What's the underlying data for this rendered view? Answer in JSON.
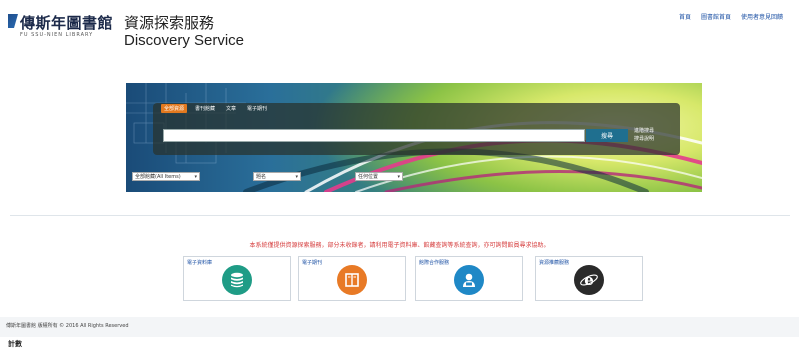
{
  "header": {
    "logo_text": "傳斯年圖書館",
    "logo_subtext": "FU SSU-NIEN LIBRARY",
    "title_zh": "資源探索服務",
    "title_en": "Discovery Service",
    "links": [
      {
        "label": "首頁"
      },
      {
        "label": "圖書館首頁"
      },
      {
        "label": "使用者意見回饋"
      }
    ]
  },
  "search": {
    "tabs": [
      {
        "label": "全部資源",
        "active": true
      },
      {
        "label": "書刊館藏",
        "active": false
      },
      {
        "label": "文章",
        "active": false
      },
      {
        "label": "電子期刊",
        "active": false
      }
    ],
    "input_value": "",
    "input_placeholder": "",
    "button_label": "搜尋",
    "advanced_label": "進階搜尋",
    "help_label": "搜尋說明",
    "filters": [
      {
        "value": "全部館藏(All Items)"
      },
      {
        "value": "題名"
      },
      {
        "value": "任何位置"
      }
    ]
  },
  "notice": "本系統僅提供資源探索服務，部分未收錄者，請利用電子資料庫、館藏查詢等系統查詢，亦可詢問館員尋求協助。",
  "cards": [
    {
      "title": "電子資料庫",
      "icon": "database-icon"
    },
    {
      "title": "電子期刊",
      "icon": "book-icon"
    },
    {
      "title": "館際合作服務",
      "icon": "user-icon"
    },
    {
      "title": "資源推薦服務",
      "icon": "ie-icon"
    }
  ],
  "footer": {
    "copyright": "傅斯年圖書館 版權所有 © 2016 All Rights Reserved",
    "counter": "計數"
  },
  "colors": {
    "accent_orange": "#e3791f",
    "search_button": "#1f6f8f",
    "notice_red": "#d53b3b",
    "link_blue": "#1a4fa3"
  }
}
